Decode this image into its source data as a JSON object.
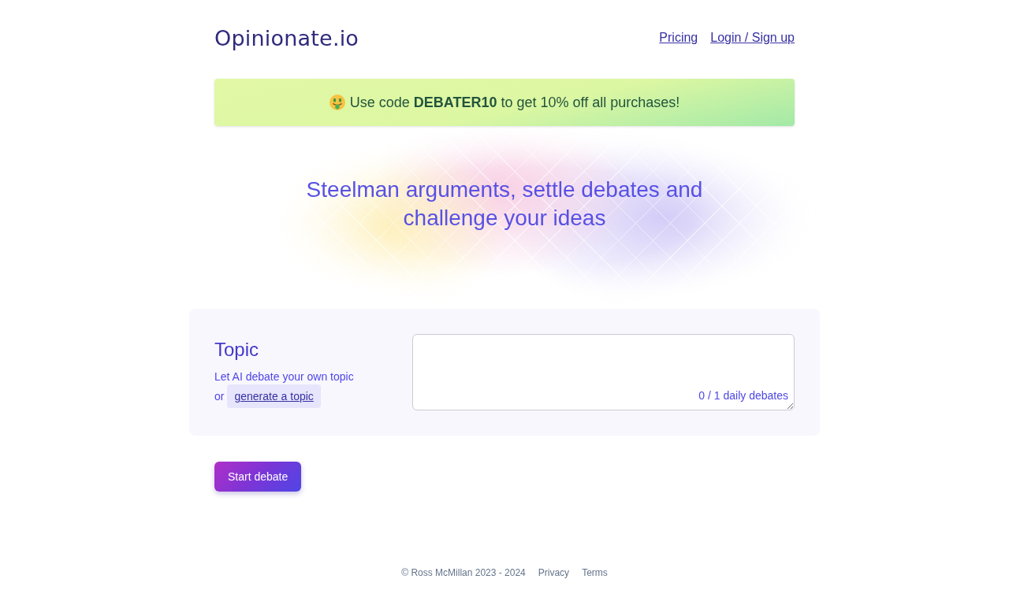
{
  "header": {
    "logo": "Opinionate.io",
    "nav_links": [
      "Pricing",
      "Login / Sign up"
    ]
  },
  "promo_banner": {
    "text": "Use code **DEBATER10** to get 10% off all purchases!"
  },
  "hero": {
    "headline": "Steelman arguments, settle debates and challenge your ideas"
  },
  "topic_card": {
    "title": "Topic",
    "description": "Let AI debate your own topic",
    "prefix": "or",
    "generate_link": "generate a topic",
    "topic_field": {
      "counter": "0 / 1 daily debates"
    }
  },
  "start_button": "Start debate",
  "footer": {
    "copyright": "© Ross McMillan 2023 - 2024",
    "links": [
      "Privacy",
      "Terms"
    ]
  }
}
